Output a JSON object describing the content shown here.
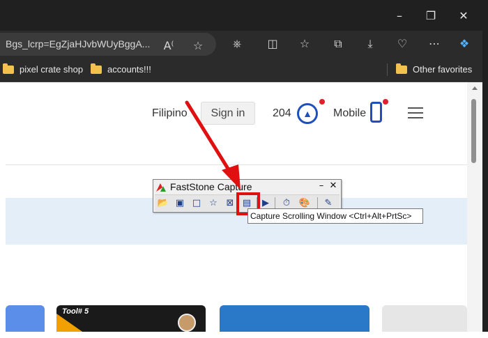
{
  "window": {
    "minimize_icon": "minimize-icon",
    "restore_icon": "restore-icon",
    "close_icon": "close-icon"
  },
  "browser": {
    "address_text": "Bgs_lcrp=EgZjaHJvbWUyBggA...",
    "toolbar_icons": [
      "read-aloud-icon",
      "favorite-star-icon",
      "extensions-icon",
      "split-screen-icon",
      "favorites-icon",
      "collections-icon",
      "downloads-icon",
      "health-icon",
      "more-icon",
      "copilot-icon"
    ]
  },
  "bookmarks": {
    "item1": "pixel crate shop",
    "item2": "accounts!!!",
    "other": "Other favorites"
  },
  "page": {
    "language": "Filipino",
    "signin": "Sign in",
    "count": "204",
    "mobile": "Mobile",
    "thumb_label": "Tool# 5"
  },
  "faststone": {
    "title": "FastStone Capture",
    "minimize": "–",
    "close": "✕",
    "tools": [
      "open-icon",
      "capture-window-icon",
      "capture-rectangle-icon",
      "capture-freehand-icon",
      "capture-fullscreen-icon",
      "capture-scrolling-window-icon",
      "screen-recorder-icon",
      "delay-timer-icon",
      "color-picker-icon",
      "settings-icon"
    ],
    "tooltip": "Capture Scrolling Window <Ctrl+Alt+PrtSc>"
  },
  "colors": {
    "accent_red": "#e01010",
    "brand_blue": "#1f4fb8",
    "titlebar": "#202020"
  }
}
